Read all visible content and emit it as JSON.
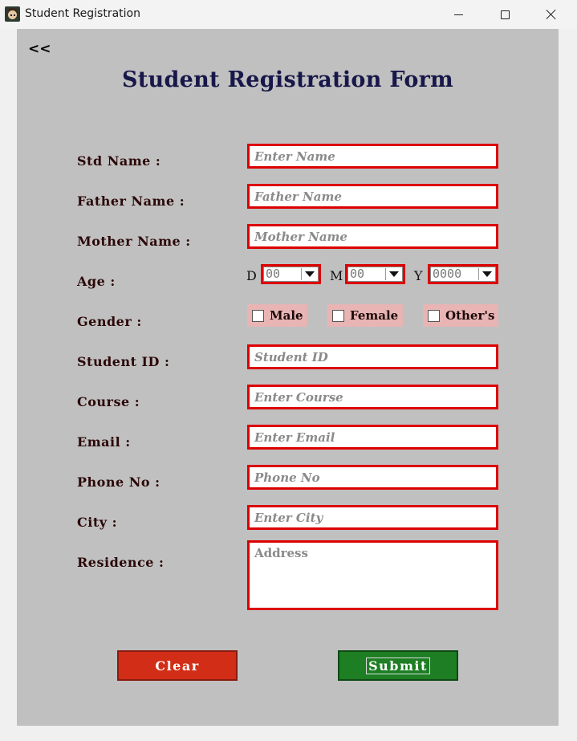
{
  "window": {
    "title": "Student Registration",
    "controls": {
      "minimize": "minimize-icon",
      "maximize": "maximize-icon",
      "close": "close-icon"
    }
  },
  "back_label": "<<",
  "form_title": "Student Registration Form",
  "labels": {
    "std_name": "Std Name :",
    "father_name": "Father Name :",
    "mother_name": "Mother Name :",
    "age": "Age :",
    "gender": "Gender :",
    "student_id": "Student ID :",
    "course": "Course :",
    "email": "Email :",
    "phone": "Phone No :",
    "city": "City :",
    "residence": "Residence :"
  },
  "placeholders": {
    "std_name": "Enter Name",
    "father_name": "Father Name",
    "mother_name": "Mother Name",
    "student_id": "Student ID",
    "course": "Enter Course",
    "email": "Enter Email",
    "phone": "Phone No",
    "city": "Enter City",
    "residence": "Address"
  },
  "age": {
    "day_label": "D",
    "day_value": "00",
    "month_label": "M",
    "month_value": "00",
    "year_label": "Y",
    "year_value": "0000"
  },
  "gender_options": [
    "Male",
    "Female",
    "Other's"
  ],
  "buttons": {
    "clear": "Clear",
    "submit": "Submit"
  },
  "colors": {
    "panel": "#c0c0c0",
    "title": "#17174a",
    "field_border": "#dd0000",
    "gender_bg": "#e8b4b4",
    "clear": "#d22d16",
    "submit": "#1d7e24"
  }
}
